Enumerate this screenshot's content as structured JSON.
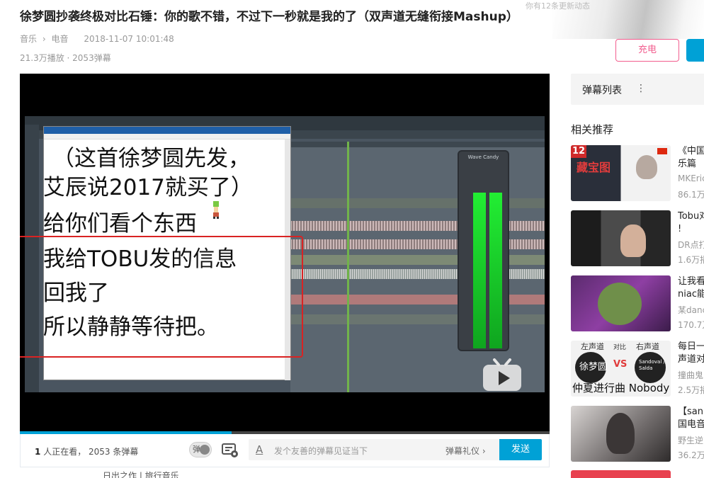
{
  "video": {
    "title": "徐梦圆抄袭终极对比石锤：你的歌不错，不过下一秒就是我的了（双声道无缝衔接Mashup）",
    "category": "音乐",
    "subcategory": "电音",
    "date": "2018-11-07 10:01:48",
    "stats": "21.3万播放 · 2053弹幕"
  },
  "header": {
    "corner_text": "你有12条更新动态",
    "charge_label": "充电"
  },
  "subtitles": [
    "（这首徐梦圆先发，",
    "艾辰说2017就买了）",
    "给你们看个东西",
    "我给TOBU发的信息",
    "回我了",
    "所以静静等待把。"
  ],
  "player": {
    "daw_meter_label": "Wave Candy",
    "progress_fraction": 0.4,
    "viewers_count": "1",
    "viewers_text": "人正在看，",
    "danmaku_count_text": "2053 条弹幕",
    "danmaku_toggle_label": "弹",
    "danmaku_placeholder": "发个友善的弹幕见证当下",
    "danmaku_etiquette": "弹幕礼仪 ›",
    "send_label": "发送"
  },
  "sidebar": {
    "danmaku_list_label": "弹幕列表",
    "danmaku_list_more": "⋮",
    "recommend_title": "相关推荐",
    "items": [
      {
        "title1": "《中国",
        "title2": "乐篇",
        "uploader": "MKEric",
        "views": "86.1万"
      },
      {
        "title1": "Tobu对",
        "title2": "!",
        "uploader": "DR点打",
        "views": "1.6万播"
      },
      {
        "title1": "让我看",
        "title2": "niac能",
        "uploader": "某dance",
        "views": "170.7万"
      },
      {
        "title1": "每日一",
        "title2": "声道对",
        "uploader": "撞曲鬼",
        "views": "2.5万播"
      },
      {
        "title1": "【san",
        "title2": "国电音",
        "uploader": "野生逆",
        "views": "36.2万"
      }
    ],
    "thumb_texts": {
      "t1_badge": "12",
      "t1_left": "藏宝图",
      "t4_a": "左声道",
      "t4_b": "对比",
      "t4_c": "右声道",
      "t4_name": "徐梦圆",
      "t4_vs": "VS",
      "t4_right": "Sandoval / Salda",
      "t4_bottom": "仲夏进行曲 Nobody"
    }
  },
  "footer": {
    "text": "日出之作 | 旅行音乐"
  },
  "colors": {
    "accent": "#00a1d6",
    "pink": "#f25d8e",
    "highlight_box": "#d92323"
  }
}
